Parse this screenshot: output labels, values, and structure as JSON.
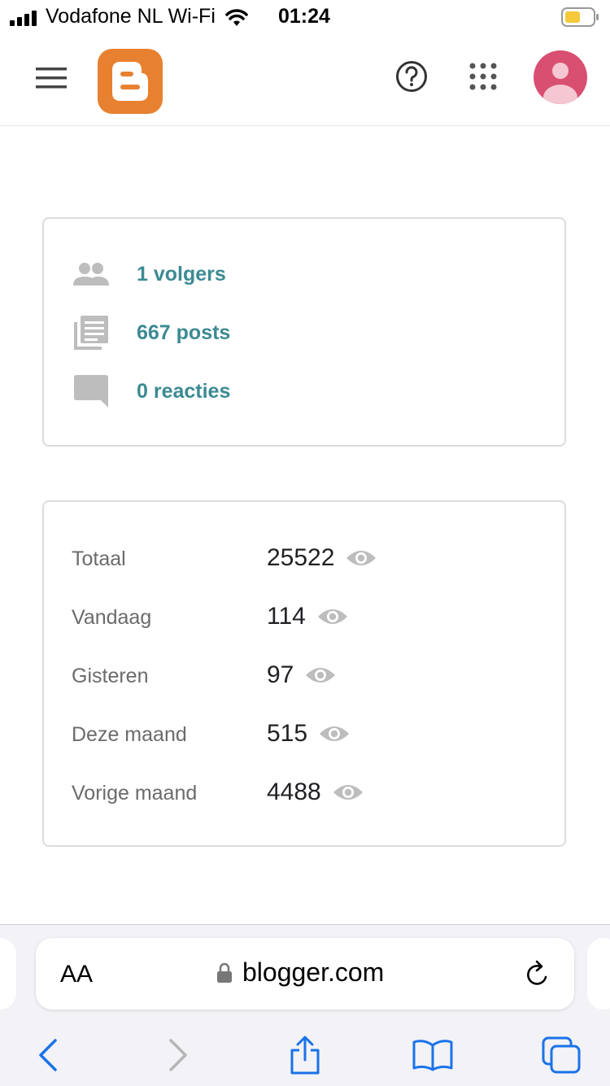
{
  "status_bar": {
    "carrier": "Vodafone NL Wi-Fi",
    "time": "01:24"
  },
  "header": {
    "icons": [
      "menu-icon",
      "blogger-logo",
      "help-icon",
      "apps-grid-icon",
      "account-avatar"
    ],
    "brand_color": "#e8812f",
    "avatar_color": "#d94f72"
  },
  "stats": {
    "followers": "1 volgers",
    "posts": "667 posts",
    "comments": "0 reacties",
    "link_color": "#3c8a93"
  },
  "views": [
    {
      "label": "Totaal",
      "value": "25522"
    },
    {
      "label": "Vandaag",
      "value": "114"
    },
    {
      "label": "Gisteren",
      "value": "97"
    },
    {
      "label": "Deze maand",
      "value": "515"
    },
    {
      "label": "Vorige maand",
      "value": "4488"
    }
  ],
  "browser": {
    "text_size_label": "AA",
    "url": "blogger.com",
    "accent_color": "#1a73e8"
  }
}
